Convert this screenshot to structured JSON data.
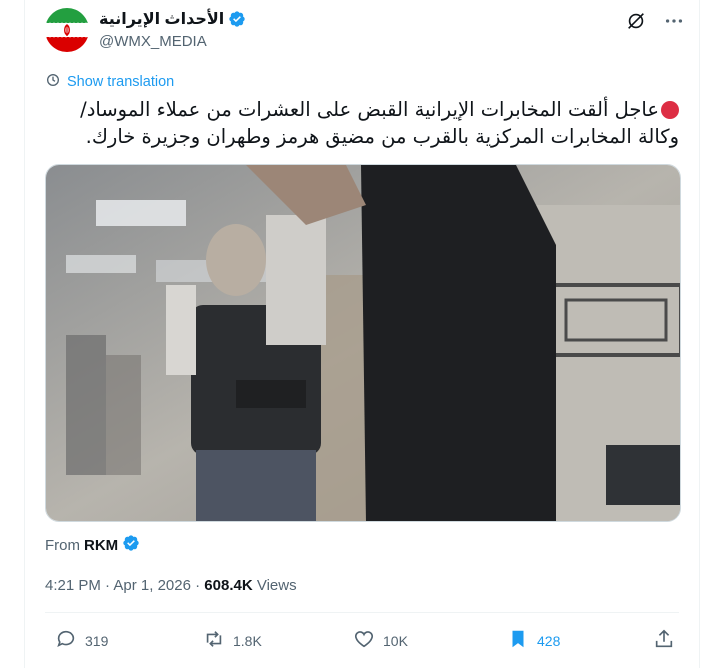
{
  "author": {
    "display_name": "الأحداث الإيرانية",
    "handle": "@WMX_MEDIA",
    "verified": true,
    "flag_colors": {
      "green": "#239f40",
      "white": "#ffffff",
      "red": "#da0000"
    }
  },
  "header_icons": [
    "grok-icon",
    "more-icon"
  ],
  "translation": {
    "label": "Show translation"
  },
  "tweet": {
    "text": "عاجل ألقت المخابرات الإيرانية القبض على العشرات من عملاء الموساد/وكالة المخابرات المركزية بالقرب من مضيق هرمز وطهران وجزيرة خارك."
  },
  "media": {
    "type": "video"
  },
  "source": {
    "prefix": "From",
    "name": "RKM",
    "verified": true
  },
  "meta": {
    "time": "4:21 PM",
    "sep1": "·",
    "date": "Apr 1, 2026",
    "sep2": "·",
    "views_count": "608.4K",
    "views_label": "Views"
  },
  "actions": {
    "replies": "319",
    "reposts": "1.8K",
    "likes": "10K",
    "bookmarks": "428"
  },
  "colors": {
    "accent": "#1d9bf0",
    "secondary_text": "#536471",
    "primary_text": "#0f1419"
  }
}
